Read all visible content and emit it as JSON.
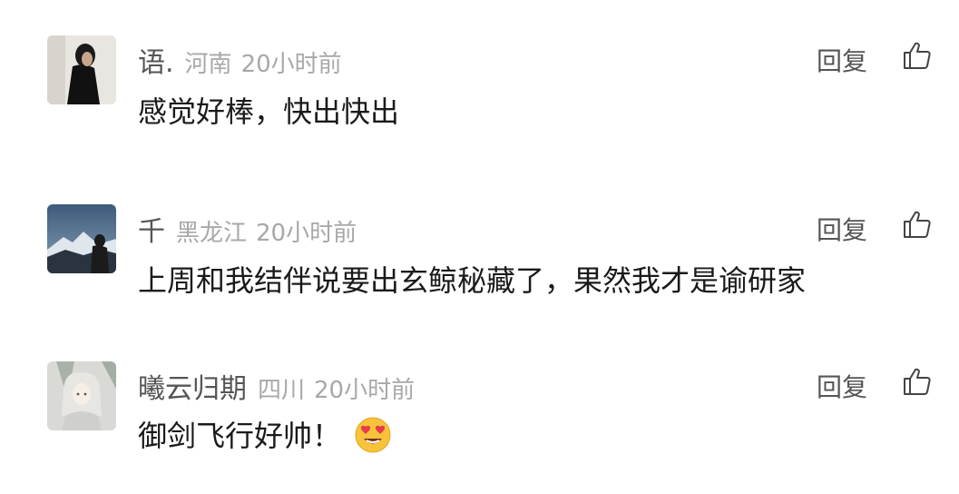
{
  "comments": [
    {
      "username": "语.",
      "location": "河南",
      "time": "20小时前",
      "text": "感觉好棒，快出快出",
      "reply_label": "回复"
    },
    {
      "username": "千",
      "location": "黑龙江",
      "time": "20小时前",
      "text": "上周和我结伴说要出玄鲸秘藏了，果然我才是谕研家",
      "reply_label": "回复"
    },
    {
      "username": "曦云归期",
      "location": "四川",
      "time": "20小时前",
      "text": "御剑飞行好帅！",
      "reply_label": "回复",
      "emoji": "heart-eyes-emoji"
    }
  ],
  "icons": {
    "like": "thumbs-up-icon"
  }
}
